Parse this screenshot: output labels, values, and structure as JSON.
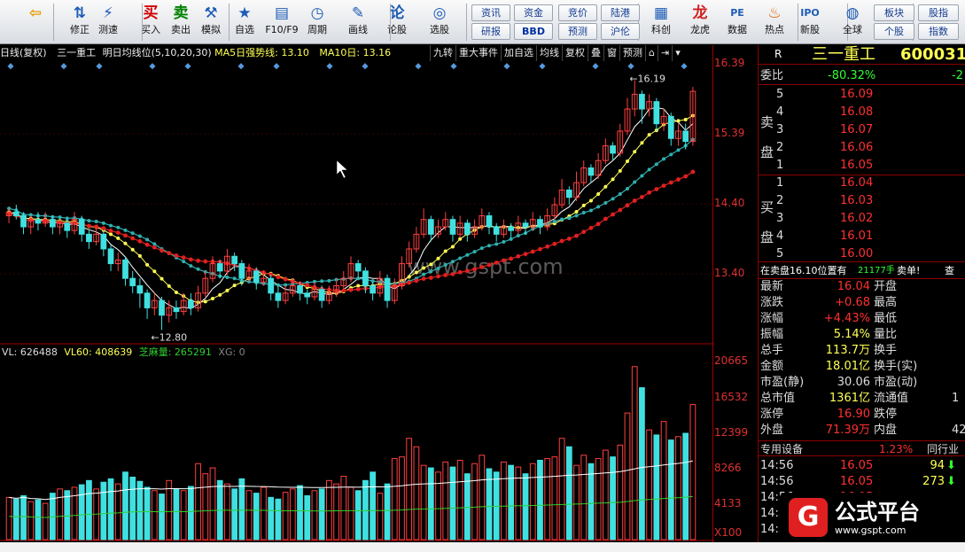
{
  "toolbar": {
    "buttons": [
      {
        "label": "",
        "icon": "back-arrow-icon",
        "glyph": "⇦"
      },
      {
        "label": "修正",
        "icon": "up-down-arrows-icon",
        "glyph": "⇅"
      },
      {
        "label": "测速",
        "icon": "speed-icon",
        "glyph": "⚡"
      },
      {
        "label": "买入",
        "icon": "buy-icon",
        "glyph": "买"
      },
      {
        "label": "卖出",
        "icon": "sell-icon",
        "glyph": "卖"
      },
      {
        "label": "模拟",
        "icon": "hammer-icon",
        "glyph": "⚒"
      },
      {
        "label": "自选",
        "icon": "star-folder-icon",
        "glyph": "★"
      },
      {
        "label": "F10/F9",
        "icon": "f10-icon",
        "glyph": "▤"
      },
      {
        "label": "周期",
        "icon": "clock-icon",
        "glyph": "◷"
      },
      {
        "label": "画线",
        "icon": "pencil-icon",
        "glyph": "✎"
      },
      {
        "label": "论股",
        "icon": "discuss-icon",
        "glyph": "论"
      },
      {
        "label": "选股",
        "icon": "stock-pick-icon",
        "glyph": "◎"
      }
    ],
    "small_buttons": [
      "资讯",
      "资金",
      "竞价",
      "陆港",
      "研报",
      "BBD",
      "预测",
      "沪伦"
    ],
    "right_buttons": [
      {
        "label": "科创",
        "icon": "chart-icon",
        "glyph": "▦"
      },
      {
        "label": "龙虎",
        "icon": "dragon-icon",
        "glyph": "龙"
      },
      {
        "label": "数据",
        "icon": "pe-icon",
        "glyph": "PE"
      },
      {
        "label": "热点",
        "icon": "fire-icon",
        "glyph": "♨"
      },
      {
        "label": "新股",
        "icon": "ipo-icon",
        "glyph": "IPO"
      },
      {
        "label": "全球",
        "icon": "globe-icon",
        "glyph": "◍"
      }
    ],
    "far_buttons": [
      "板块",
      "股指",
      "个股",
      "指数"
    ]
  },
  "infobar": {
    "period": "日线(复权)",
    "stock": "三一重工",
    "formula": "明日均线位(5,10,20,30)",
    "ma5": "MA5日强势线: 13.10",
    "ma10": "MA10日: 13.16"
  },
  "tabs": [
    "九转",
    "重大事件",
    "加自选",
    "均线",
    "复权",
    "叠",
    "窗",
    "预测"
  ],
  "price_axis": [
    "16.39",
    "15.39",
    "14.40",
    "13.40"
  ],
  "annotations": {
    "high": "16.19",
    "low": "12.80"
  },
  "watermark": "www.gspt.com",
  "volume": {
    "vl": "VL: 626488",
    "vl60": "VL60: 408639",
    "sesame": "芝麻量: 265291",
    "xg": "XG: 0"
  },
  "vol_axis": [
    "20665",
    "16532",
    "12399",
    "8266",
    "4133",
    "X100"
  ],
  "quote": {
    "name": "三一重工",
    "code": "600031",
    "r": "R",
    "weibi_label": "委比",
    "weibi": "-80.32%",
    "weibi2": "-2",
    "sell_label": [
      "卖",
      "盘"
    ],
    "buy_label": [
      "买",
      "盘"
    ],
    "sell": [
      [
        "5",
        "16.09"
      ],
      [
        "4",
        "16.08"
      ],
      [
        "3",
        "16.07"
      ],
      [
        "2",
        "16.06"
      ],
      [
        "1",
        "16.05"
      ]
    ],
    "buy": [
      [
        "1",
        "16.04"
      ],
      [
        "2",
        "16.03"
      ],
      [
        "3",
        "16.02"
      ],
      [
        "4",
        "16.01"
      ],
      [
        "5",
        "16.00"
      ]
    ],
    "notice": "在卖盘16.10位置有",
    "notice_vol": "21177手",
    "notice_end": "卖单!",
    "notice_btn": "查",
    "stats": [
      [
        "最新",
        "16.04",
        "开盘",
        ""
      ],
      [
        "涨跌",
        "+0.68",
        "最高",
        ""
      ],
      [
        "涨幅",
        "+4.43%",
        "最低",
        ""
      ],
      [
        "振幅",
        "5.14%",
        "量比",
        ""
      ],
      [
        "总手",
        "113.7万",
        "换手",
        ""
      ],
      [
        "金额",
        "18.01亿",
        "换手(实)",
        ""
      ],
      [
        "市盈(静)",
        "30.06",
        "市盈(动)",
        ""
      ],
      [
        "总市值",
        "1361亿",
        "流通值",
        "1"
      ],
      [
        "涨停",
        "16.90",
        "跌停",
        ""
      ],
      [
        "外盘",
        "71.39万",
        "内盘",
        "42"
      ]
    ],
    "device_label": "专用设备",
    "device_pct": "1.23%",
    "industry_label": "同行业",
    "ticks": [
      [
        "14:56",
        "16.05",
        "94"
      ],
      [
        "14:56",
        "16.05",
        "273"
      ],
      [
        "14:56",
        "16.05",
        ""
      ],
      [
        "14:5",
        "",
        ""
      ],
      [
        "14:5",
        "",
        ""
      ]
    ]
  },
  "logo": {
    "text": "公式平台",
    "url": "www.gspt.com"
  },
  "chart_data": {
    "type": "candlestick",
    "ylim": [
      12.6,
      16.45
    ],
    "title": "",
    "xlabel": "",
    "ylabel": "",
    "candles": [
      [
        14.35,
        14.4,
        14.45,
        14.25
      ],
      [
        14.4,
        14.35,
        14.5,
        14.3
      ],
      [
        14.35,
        14.2,
        14.4,
        14.1
      ],
      [
        14.2,
        14.3,
        14.35,
        14.1
      ],
      [
        14.3,
        14.25,
        14.4,
        14.15
      ],
      [
        14.25,
        14.3,
        14.4,
        14.2
      ],
      [
        14.3,
        14.2,
        14.35,
        14.1
      ],
      [
        14.2,
        14.25,
        14.3,
        14.1
      ],
      [
        14.25,
        14.15,
        14.3,
        14.05
      ],
      [
        14.15,
        14.3,
        14.4,
        14.1
      ],
      [
        14.3,
        14.1,
        14.35,
        14.0
      ],
      [
        14.1,
        14.0,
        14.15,
        13.9
      ],
      [
        14.0,
        14.1,
        14.2,
        13.95
      ],
      [
        14.1,
        13.9,
        14.15,
        13.8
      ],
      [
        13.9,
        13.7,
        13.95,
        13.6
      ],
      [
        13.7,
        13.75,
        13.85,
        13.6
      ],
      [
        13.75,
        13.5,
        13.8,
        13.4
      ],
      [
        13.5,
        13.4,
        13.6,
        13.3
      ],
      [
        13.4,
        13.3,
        13.5,
        13.1
      ],
      [
        13.3,
        13.1,
        13.35,
        12.95
      ],
      [
        13.1,
        13.2,
        13.3,
        13.0
      ],
      [
        13.2,
        13.0,
        13.25,
        12.8
      ],
      [
        13.0,
        13.1,
        13.2,
        12.9
      ],
      [
        13.1,
        13.05,
        13.2,
        12.95
      ],
      [
        13.05,
        13.2,
        13.3,
        13.0
      ],
      [
        13.2,
        13.1,
        13.3,
        13.0
      ],
      [
        13.1,
        13.3,
        13.4,
        13.05
      ],
      [
        13.3,
        13.5,
        13.6,
        13.25
      ],
      [
        13.5,
        13.7,
        13.8,
        13.45
      ],
      [
        13.7,
        13.6,
        13.75,
        13.5
      ],
      [
        13.6,
        13.8,
        13.9,
        13.55
      ],
      [
        13.8,
        13.7,
        13.85,
        13.6
      ],
      [
        13.7,
        13.5,
        13.75,
        13.4
      ],
      [
        13.5,
        13.6,
        13.7,
        13.45
      ],
      [
        13.6,
        13.45,
        13.65,
        13.35
      ],
      [
        13.45,
        13.5,
        13.6,
        13.4
      ],
      [
        13.5,
        13.3,
        13.55,
        13.2
      ],
      [
        13.3,
        13.2,
        13.4,
        13.1
      ],
      [
        13.2,
        13.3,
        13.4,
        13.15
      ],
      [
        13.3,
        13.4,
        13.5,
        13.25
      ],
      [
        13.4,
        13.3,
        13.45,
        13.2
      ],
      [
        13.3,
        13.25,
        13.35,
        13.15
      ],
      [
        13.25,
        13.35,
        13.45,
        13.2
      ],
      [
        13.35,
        13.2,
        13.4,
        13.1
      ],
      [
        13.2,
        13.3,
        13.4,
        13.15
      ],
      [
        13.3,
        13.4,
        13.5,
        13.25
      ],
      [
        13.4,
        13.5,
        13.6,
        13.35
      ],
      [
        13.5,
        13.7,
        13.8,
        13.45
      ],
      [
        13.7,
        13.6,
        13.75,
        13.5
      ],
      [
        13.6,
        13.4,
        13.65,
        13.3
      ],
      [
        13.4,
        13.3,
        13.45,
        13.2
      ],
      [
        13.3,
        13.5,
        13.6,
        13.25
      ],
      [
        13.5,
        13.2,
        13.55,
        13.1
      ],
      [
        13.2,
        13.4,
        13.5,
        13.15
      ],
      [
        13.4,
        13.7,
        13.8,
        13.35
      ],
      [
        13.7,
        13.9,
        14.0,
        13.65
      ],
      [
        13.9,
        14.1,
        14.2,
        13.85
      ],
      [
        14.1,
        14.3,
        14.45,
        14.05
      ],
      [
        14.3,
        14.1,
        14.35,
        14.0
      ],
      [
        14.1,
        14.2,
        14.3,
        14.05
      ],
      [
        14.2,
        14.3,
        14.4,
        14.15
      ],
      [
        14.3,
        14.1,
        14.35,
        14.0
      ],
      [
        14.1,
        14.25,
        14.35,
        14.05
      ],
      [
        14.25,
        14.1,
        14.3,
        14.0
      ],
      [
        14.1,
        14.2,
        14.3,
        14.05
      ],
      [
        14.2,
        14.35,
        14.45,
        14.15
      ],
      [
        14.35,
        14.2,
        14.4,
        14.1
      ],
      [
        14.2,
        14.1,
        14.25,
        14.0
      ],
      [
        14.1,
        14.2,
        14.3,
        14.05
      ],
      [
        14.2,
        14.15,
        14.25,
        14.05
      ],
      [
        14.15,
        14.25,
        14.35,
        14.1
      ],
      [
        14.25,
        14.2,
        14.3,
        14.1
      ],
      [
        14.2,
        14.3,
        14.4,
        14.15
      ],
      [
        14.3,
        14.2,
        14.35,
        14.1
      ],
      [
        14.2,
        14.35,
        14.45,
        14.15
      ],
      [
        14.35,
        14.5,
        14.6,
        14.3
      ],
      [
        14.5,
        14.7,
        14.85,
        14.45
      ],
      [
        14.7,
        14.6,
        14.75,
        14.5
      ],
      [
        14.6,
        14.8,
        14.95,
        14.55
      ],
      [
        14.8,
        15.0,
        15.1,
        14.75
      ],
      [
        15.0,
        14.9,
        15.05,
        14.8
      ],
      [
        14.9,
        15.1,
        15.2,
        14.85
      ],
      [
        15.1,
        15.3,
        15.4,
        15.05
      ],
      [
        15.3,
        15.2,
        15.35,
        15.1
      ],
      [
        15.2,
        15.5,
        15.6,
        15.15
      ],
      [
        15.5,
        15.8,
        15.95,
        15.45
      ],
      [
        15.8,
        16.0,
        16.19,
        15.7
      ],
      [
        16.0,
        15.8,
        16.05,
        15.6
      ],
      [
        15.8,
        15.9,
        16.0,
        15.7
      ],
      [
        15.9,
        15.6,
        15.95,
        15.5
      ],
      [
        15.6,
        15.7,
        15.8,
        15.5
      ],
      [
        15.7,
        15.4,
        15.75,
        15.3
      ],
      [
        15.4,
        15.5,
        15.6,
        15.3
      ],
      [
        15.5,
        15.36,
        15.6,
        15.25
      ],
      [
        15.36,
        16.04,
        16.1,
        15.3
      ]
    ],
    "ma_colors": [
      "#ffffff",
      "#ffff55",
      "#30b0b0",
      "#e02020"
    ],
    "volume": [
      50,
      48,
      52,
      45,
      47,
      43,
      55,
      60,
      58,
      62,
      65,
      70,
      60,
      68,
      72,
      66,
      80,
      74,
      69,
      62,
      58,
      54,
      70,
      60,
      58,
      63,
      90,
      78,
      85,
      70,
      66,
      60,
      72,
      58,
      55,
      62,
      50,
      48,
      56,
      60,
      64,
      52,
      58,
      60,
      70,
      66,
      75,
      62,
      58,
      70,
      80,
      55,
      66,
      96,
      98,
      120,
      110,
      88,
      85,
      80,
      92,
      86,
      94,
      78,
      90,
      100,
      84,
      80,
      92,
      88,
      86,
      78,
      90,
      94,
      96,
      98,
      120,
      110,
      88,
      100,
      90,
      96,
      106,
      98,
      112,
      150,
      205,
      180,
      130,
      124,
      140,
      118,
      122,
      126,
      160
    ]
  }
}
